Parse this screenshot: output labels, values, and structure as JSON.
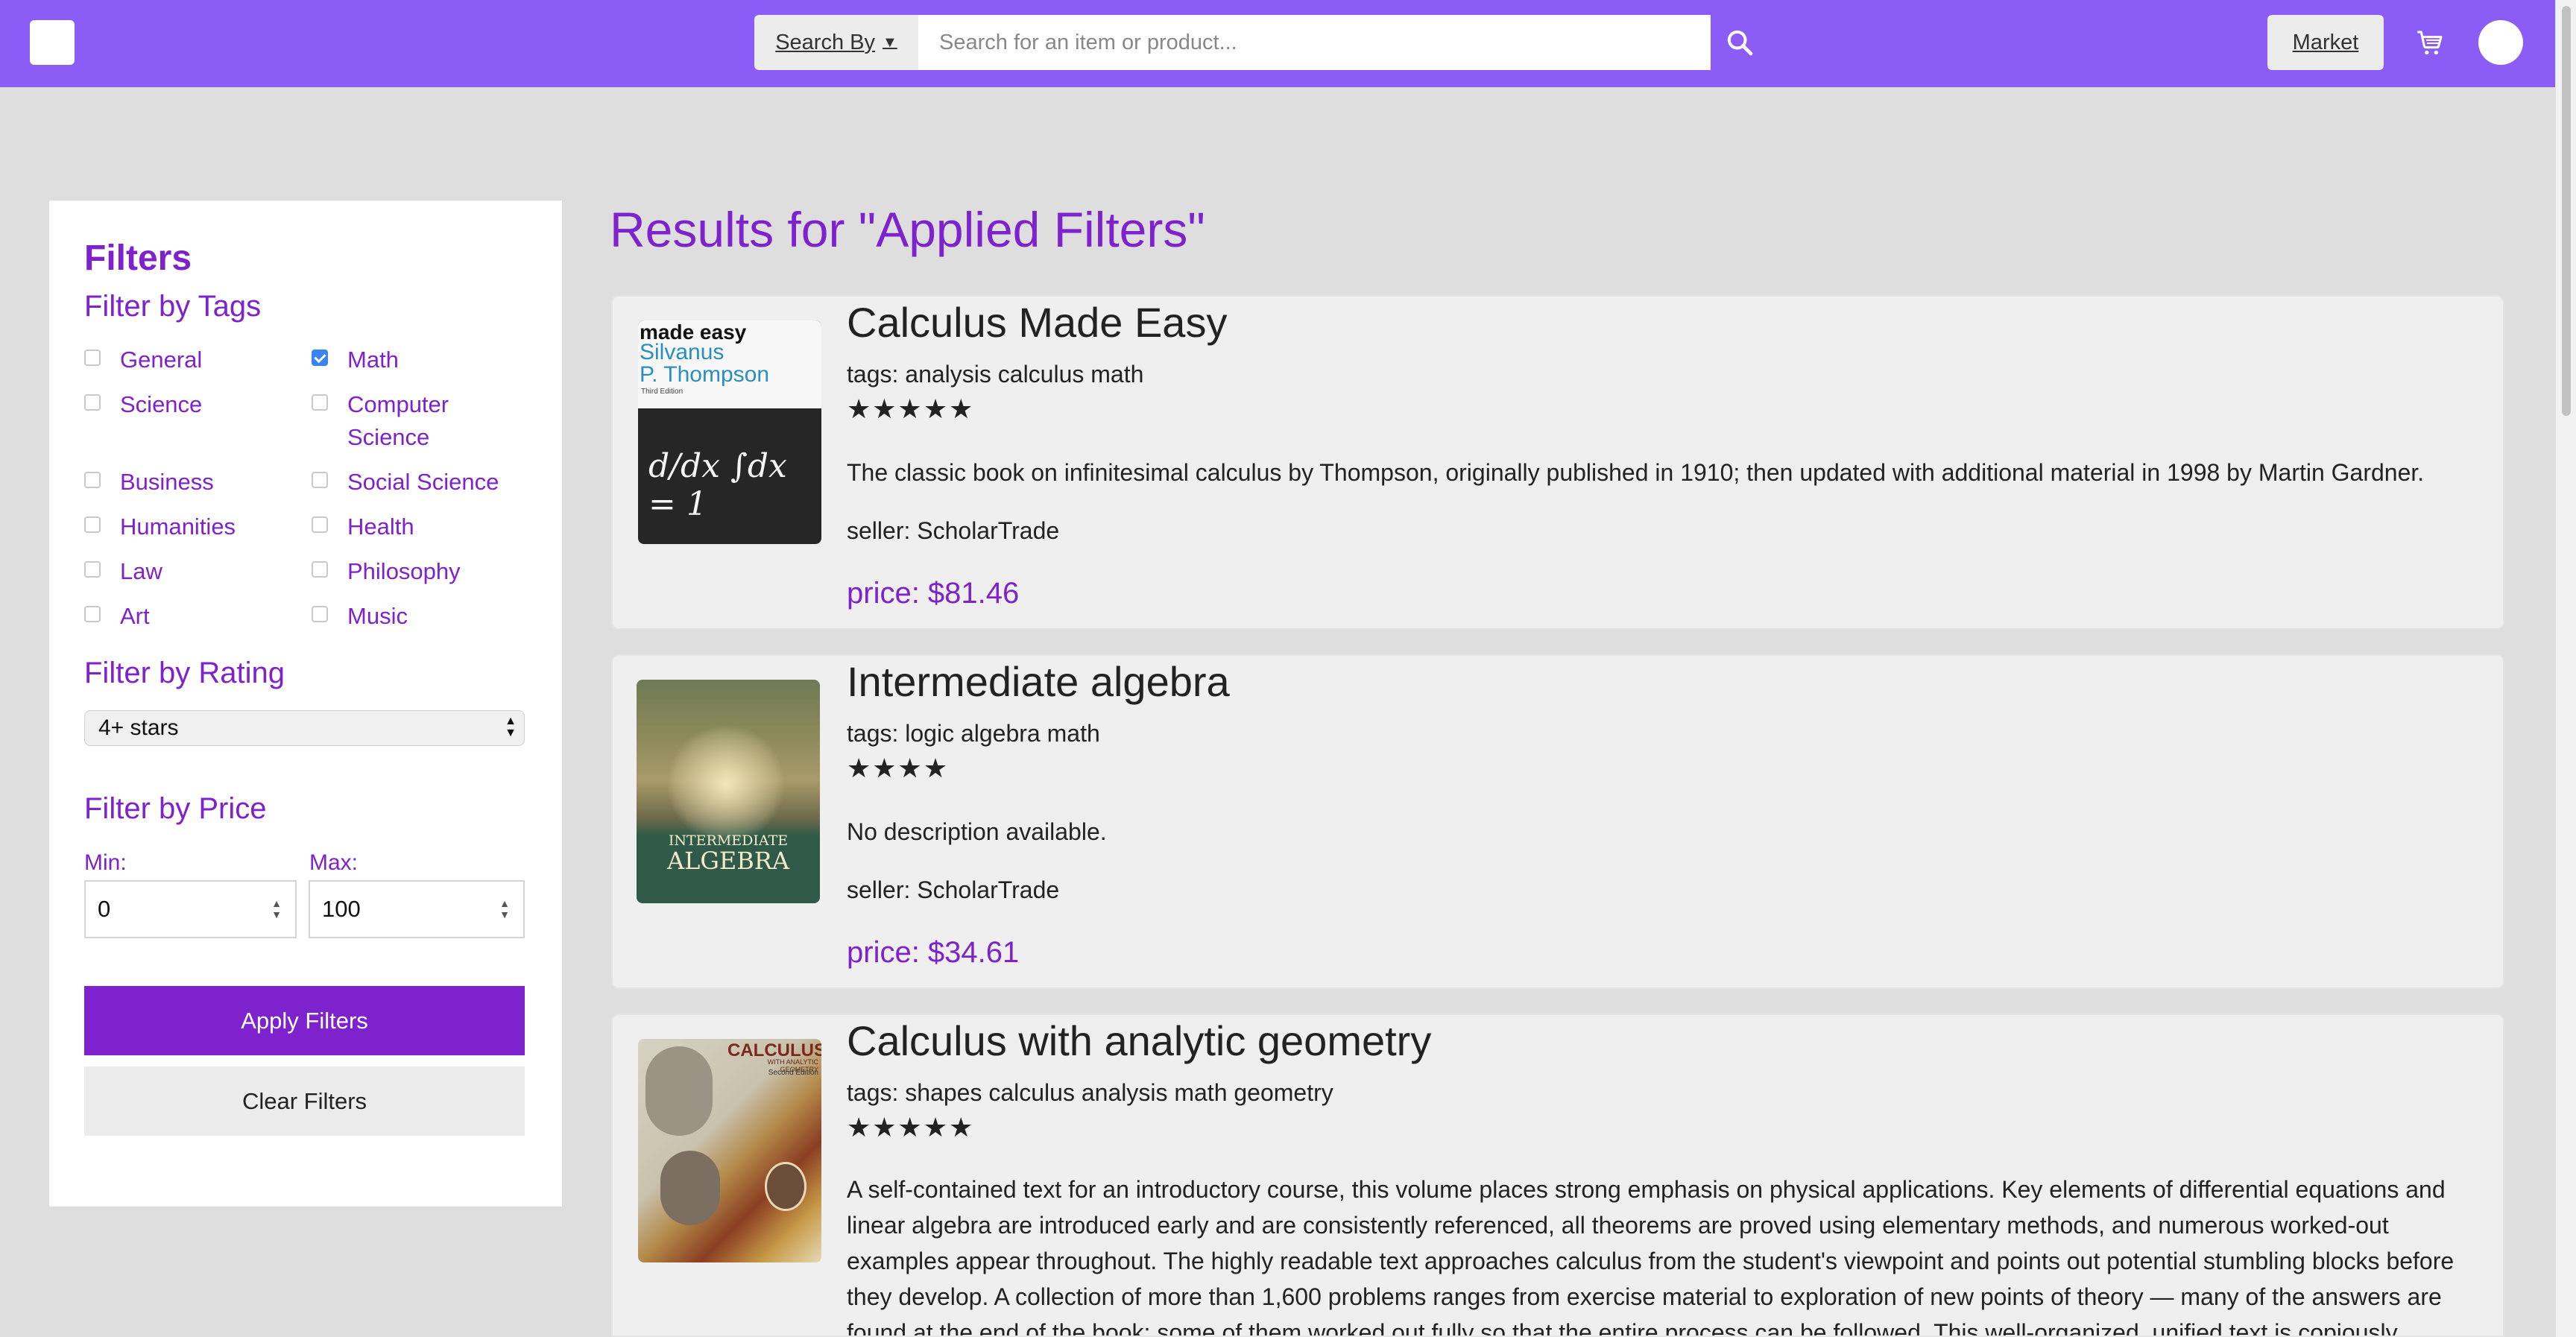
{
  "header": {
    "search_by_label": "Search By",
    "search_placeholder": "Search for an item or product...",
    "search_value": "",
    "market_label": "Market",
    "colors": {
      "bar": "#8b5cf6",
      "accent": "#7e22ce"
    }
  },
  "sidebar": {
    "title": "Filters",
    "tags_heading": "Filter by Tags",
    "tags": [
      {
        "label": "General",
        "checked": false
      },
      {
        "label": "Math",
        "checked": true
      },
      {
        "label": "Science",
        "checked": false
      },
      {
        "label": "Computer Science",
        "checked": false
      },
      {
        "label": "Business",
        "checked": false
      },
      {
        "label": "Social Science",
        "checked": false
      },
      {
        "label": "Humanities",
        "checked": false
      },
      {
        "label": "Health",
        "checked": false
      },
      {
        "label": "Law",
        "checked": false
      },
      {
        "label": "Philosophy",
        "checked": false
      },
      {
        "label": "Art",
        "checked": false
      },
      {
        "label": "Music",
        "checked": false
      }
    ],
    "rating_heading": "Filter by Rating",
    "rating_value": "4+ stars",
    "price_heading": "Filter by Price",
    "min_label": "Min:",
    "max_label": "Max:",
    "min_value": "0",
    "max_value": "100",
    "apply_label": "Apply Filters",
    "clear_label": "Clear Filters"
  },
  "results": {
    "heading": "Results for \"Applied Filters\"",
    "items": [
      {
        "title": "Calculus Made Easy",
        "tags": "tags: analysis calculus math",
        "rating": 5,
        "stars": "★★★★★",
        "description": "The classic book on infinitesimal calculus by Thompson, originally published in 1910; then updated with additional material in 1998 by Martin Gardner.",
        "seller": "seller: ScholarTrade",
        "price": "price: $81.46",
        "cover": {
          "line1": "made easy",
          "line2": "Silvanus",
          "line3": "P. Thompson",
          "line4": "Third Edition",
          "formula": "d/dx ∫dx = 1"
        }
      },
      {
        "title": "Intermediate algebra",
        "tags": "tags: logic algebra math",
        "rating": 4,
        "stars": "★★★★",
        "description": "No description available.",
        "seller": "seller: ScholarTrade",
        "price": "price: $34.61",
        "cover": {
          "line1": "INTERMEDIATE",
          "line2": "ALGEBRA"
        }
      },
      {
        "title": "Calculus with analytic geometry",
        "tags": "tags: shapes calculus analysis math geometry",
        "rating": 5,
        "stars": "★★★★★",
        "description": "A self-contained text for an introductory course, this volume places strong emphasis on physical applications. Key elements of differential equations and linear algebra are introduced early and are consistently referenced, all theorems are proved using elementary methods, and numerous worked-out examples appear throughout. The highly readable text approaches calculus from the student's viewpoint and points out potential stumbling blocks before they develop. A collection of more than 1,600 problems ranges from exercise material to exploration of new points of theory — many of the answers are found at the end of the book; some of them worked out fully so that the entire process can be followed. This well-organized, unified text is copiously",
        "cover": {
          "line1": "CALCULUS",
          "line2": "WITH ANALYTIC GEOMETRY",
          "line3": "Second Edition"
        }
      }
    ]
  }
}
